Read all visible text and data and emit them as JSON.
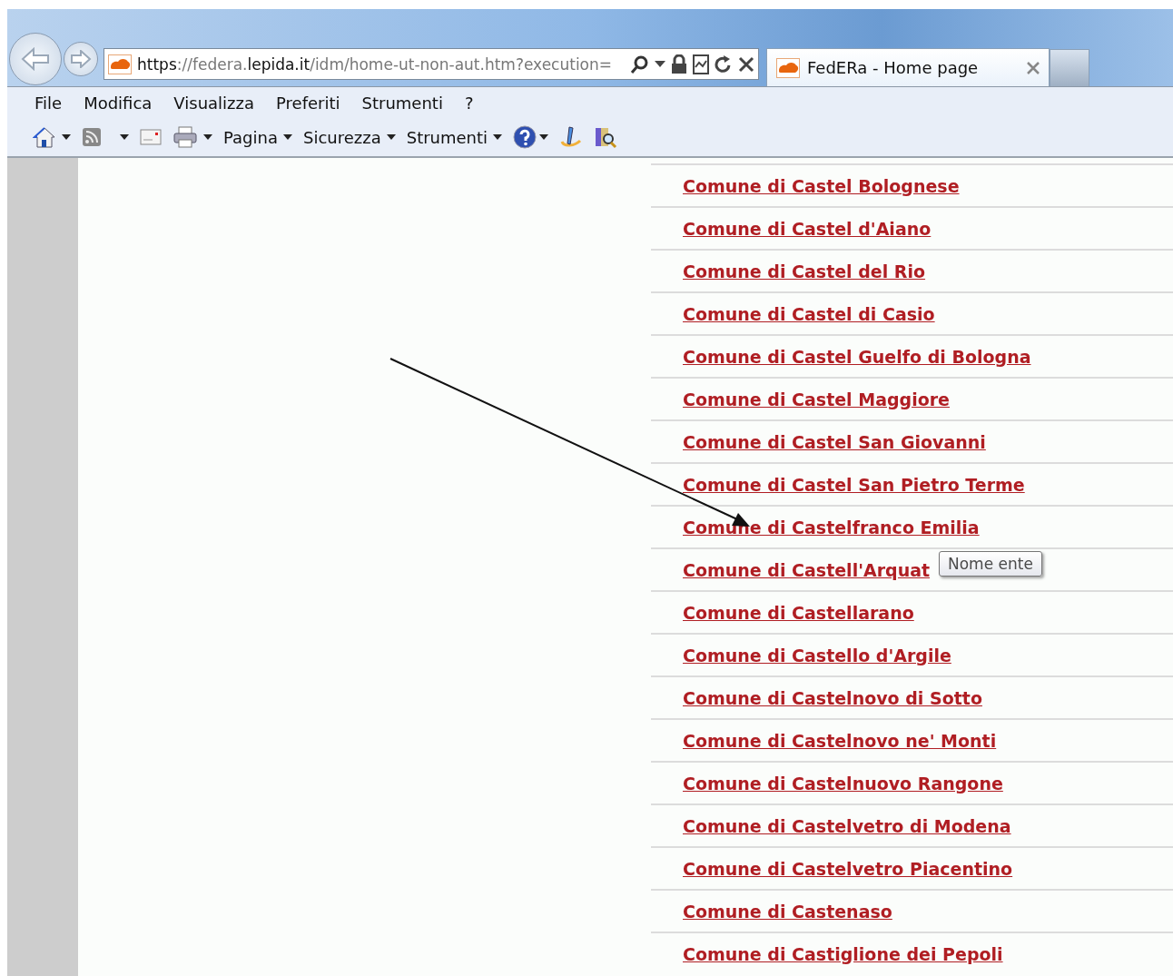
{
  "address_bar": {
    "scheme": "https",
    "host_prefix": "://federa.",
    "host": "lepida.it",
    "path": "/idm/home-ut-non-aut.htm?execution="
  },
  "tabs": [
    {
      "label": "FedERa - Home page",
      "selected": true
    }
  ],
  "menu": [
    "File",
    "Modifica",
    "Visualizza",
    "Preferiti",
    "Strumenti",
    "?"
  ],
  "commands": [
    {
      "kind": "home"
    },
    {
      "kind": "feed"
    },
    {
      "kind": "mail"
    },
    {
      "kind": "print"
    },
    {
      "kind": "menu",
      "label": "Pagina"
    },
    {
      "kind": "menu",
      "label": "Sicurezza"
    },
    {
      "kind": "menu",
      "label": "Strumenti"
    },
    {
      "kind": "help"
    },
    {
      "kind": "pen"
    },
    {
      "kind": "research"
    }
  ],
  "entities": [
    {
      "name": "Comune di Castel Bolognese"
    },
    {
      "name": "Comune di Castel d'Aiano"
    },
    {
      "name": "Comune di Castel del Rio"
    },
    {
      "name": "Comune di Castel di Casio"
    },
    {
      "name": "Comune di Castel Guelfo di Bologna"
    },
    {
      "name": "Comune di Castel Maggiore"
    },
    {
      "name": "Comune di Castel San Giovanni"
    },
    {
      "name": "Comune di Castel San Pietro Terme"
    },
    {
      "name": "Comune di Castelfranco Emilia"
    },
    {
      "name": "Comune di Castell'Arquat",
      "tooltip": "Nome ente"
    },
    {
      "name": "Comune di Castellarano"
    },
    {
      "name": "Comune di Castello d'Argile"
    },
    {
      "name": "Comune di Castelnovo di Sotto"
    },
    {
      "name": "Comune di Castelnovo ne' Monti"
    },
    {
      "name": "Comune di Castelnuovo Rangone"
    },
    {
      "name": "Comune di Castelvetro di Modena"
    },
    {
      "name": "Comune di Castelvetro Piacentino"
    },
    {
      "name": "Comune di Castenaso"
    },
    {
      "name": "Comune di Castiglione dei Pepoli"
    }
  ]
}
